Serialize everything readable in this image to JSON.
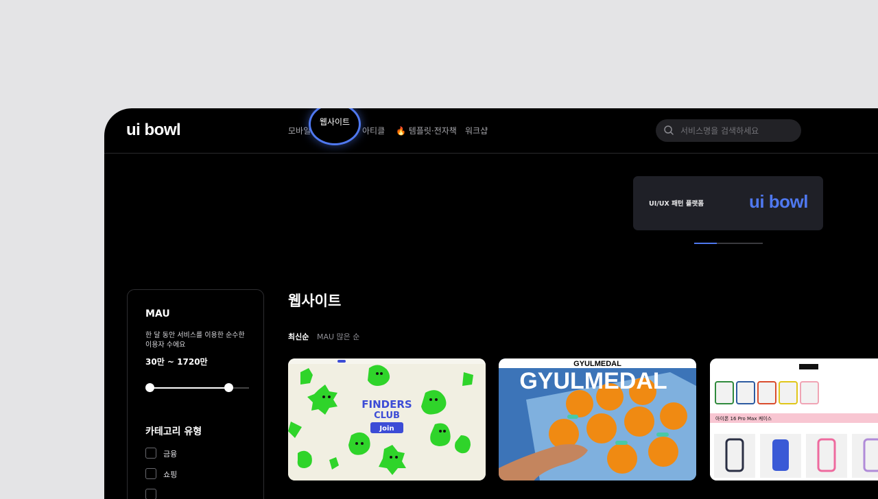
{
  "header": {
    "logo": "ui bowl",
    "nav": [
      {
        "label": "모바일"
      },
      {
        "label": "웹사이트"
      },
      {
        "label": "아티클"
      },
      {
        "label": "템플릿·전자책",
        "icon": "fire-icon"
      },
      {
        "label": "워크샵"
      }
    ],
    "search_placeholder": "서비스명을 검색하세요"
  },
  "banner": {
    "text": "UI/UX 패턴 플랫폼",
    "logo": "ui bowl",
    "indicator": {
      "current": 1,
      "total": 3
    }
  },
  "filters": {
    "mau": {
      "title": "MAU",
      "description": "한 달 동안 서비스를 이용한 순수한 이용자 수에요",
      "range": "30만 ~ 1720만"
    },
    "category": {
      "title": "카테고리 유형",
      "items": [
        {
          "label": "금융",
          "checked": false
        },
        {
          "label": "쇼핑",
          "checked": false
        }
      ]
    }
  },
  "main": {
    "title": "웹사이트",
    "sort_tabs": [
      {
        "label": "최신순",
        "active": true
      },
      {
        "label": "MAU 많은 순",
        "active": false
      }
    ],
    "cards": [
      {
        "name": "finders-club",
        "words": [
          "FINDERS",
          "CLUB"
        ],
        "button": "Join"
      },
      {
        "name": "gyulmedal",
        "brand": "GYULMEDAL",
        "headline": "GYULMEDAL"
      },
      {
        "name": "casetify",
        "heading": "아이폰 16 Pro Max 케이스"
      }
    ]
  },
  "colors": {
    "accent": "#4f78ef",
    "background": "#000000",
    "page_bg": "#e4e4e6",
    "finders_green": "#2fd42a",
    "gyulmedal_blue": "#3c74b8"
  }
}
